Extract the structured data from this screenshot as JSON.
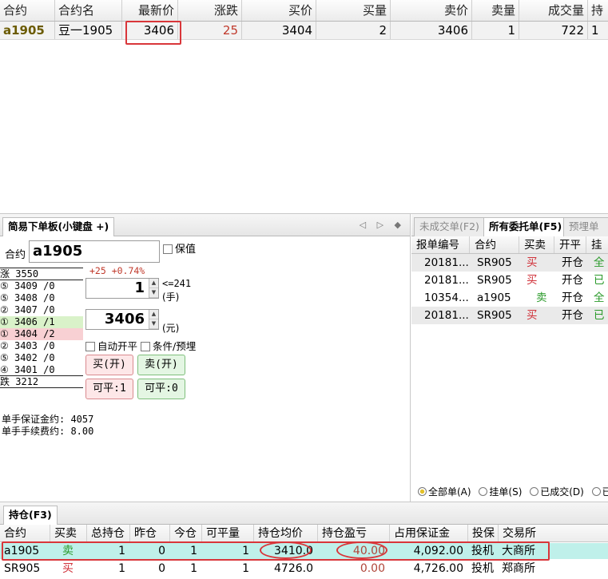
{
  "quote": {
    "columns": [
      "合约",
      "合约名",
      "最新价",
      "涨跌",
      "买价",
      "买量",
      "卖价",
      "卖量",
      "成交量",
      "持"
    ],
    "row": {
      "symbol": "a1905",
      "name": "豆一1905",
      "last": "3406",
      "change": "25",
      "bid": "3404",
      "bid_vol": "2",
      "ask": "3406",
      "ask_vol": "1",
      "volume": "722",
      "hold": "1"
    }
  },
  "order": {
    "tab_label": "简易下单板(小键盘 +)",
    "nav_arrows": "◁ ▷ ◆",
    "contract_label": "合约",
    "contract_value": "a1905",
    "hedge_label": "保值",
    "change_text": "+25 +0.74%",
    "limit_up": "涨 3550",
    "depth": [
      "⑤ 3409 /0",
      "⑤ 3408 /0",
      "② 3407 /0",
      "① 3406 /1",
      "① 3404 /2",
      "② 3403 /0",
      "⑤ 3402 /0",
      "④ 3401 /0"
    ],
    "limit_down": "跌 3212",
    "qty_value": "1",
    "qty_max": "<=241",
    "qty_unit": "(手)",
    "price_value": "3406",
    "price_unit": "(元)",
    "auto_close_label": "自动开平",
    "condition_label": "条件/预埋",
    "buy_open": "买(开)",
    "sell_open": "卖(开)",
    "close_buy": "可平:1",
    "close_sell": "可平:0",
    "margin_text": "单手保证金约: 4057",
    "fee_text": "单手手续费约: 8.00"
  },
  "entrust": {
    "tabs": [
      "未成交单(F2)",
      "所有委托单(F5)",
      "预埋单条件"
    ],
    "columns": [
      "报单编号",
      "合约",
      "买卖",
      "开平",
      "挂"
    ],
    "rows": [
      {
        "id": "20181...",
        "contract": "SR905",
        "side": "买",
        "offset": "开仓",
        "status": "全"
      },
      {
        "id": "20181...",
        "contract": "SR905",
        "side": "买",
        "offset": "开仓",
        "status": "已"
      },
      {
        "id": "10354...",
        "contract": "a1905",
        "side": "卖",
        "offset": "开仓",
        "status": "全"
      },
      {
        "id": "20181...",
        "contract": "SR905",
        "side": "买",
        "offset": "开仓",
        "status": "已"
      }
    ],
    "filters": [
      "全部单(A)",
      "挂单(S)",
      "已成交(D)",
      "已"
    ]
  },
  "position": {
    "tab_label": "持仓(F3)",
    "columns": [
      "合约",
      "买卖",
      "总持仓",
      "昨仓",
      "今仓",
      "可平量",
      "持仓均价",
      "持仓盈亏",
      "占用保证金",
      "投保",
      "交易所"
    ],
    "rows": [
      {
        "contract": "a1905",
        "side": "卖",
        "total": "1",
        "yesterday": "0",
        "today": "1",
        "closable": "1",
        "avg_price": "3410.0",
        "pnl": "40.00",
        "margin": "4,092.00",
        "hedge": "投机",
        "exchange": "大商所"
      },
      {
        "contract": "SR905",
        "side": "买",
        "total": "1",
        "yesterday": "0",
        "today": "1",
        "closable": "1",
        "avg_price": "4726.0",
        "pnl": "0.00",
        "margin": "4,726.00",
        "hedge": "投机",
        "exchange": "郑商所"
      }
    ]
  },
  "colors": {
    "buy": "#d0323a",
    "sell": "#2a9a2a",
    "highlight_box": "#d9363a"
  }
}
